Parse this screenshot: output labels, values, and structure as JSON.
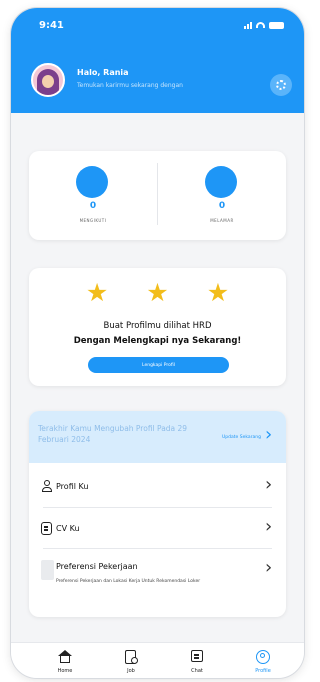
{
  "status_bar": {
    "time": "9:41",
    "icons": [
      "signal-icon",
      "wifi-icon",
      "battery-icon"
    ]
  },
  "header": {
    "greeting": "Halo, Rania",
    "subtitle": "Temukan karirmu sekarang dengan",
    "settings_icon": "gear-icon",
    "color": "#1e96f6"
  },
  "stats": [
    {
      "value": "0",
      "label": "MENGIKUTI"
    },
    {
      "value": "0",
      "label": "MELAMAR"
    }
  ],
  "promo": {
    "star_count": 3,
    "line1": "Buat Profilmu dilihat HRD",
    "line2": "Dengan Melengkapi nya Sekarang!",
    "button": "Lengkapi Profil"
  },
  "notice": {
    "text": "Terakhir Kamu Mengubah Profil Pada 29 Februari 2024",
    "link": "Update Sekarang"
  },
  "menu": [
    {
      "label": "Profil Ku",
      "icon": "person-icon"
    },
    {
      "label": "CV Ku",
      "icon": "document-icon"
    },
    {
      "label": "Preferensi Pekerjaan",
      "subtitle": "Preferensi Pekerjaan dan Lokasi Kerja Untuk Rekomendasi Loker"
    }
  ],
  "nav": [
    {
      "label": "Home",
      "icon": "home-icon"
    },
    {
      "label": "Job",
      "icon": "job-search-icon"
    },
    {
      "label": "Chat",
      "icon": "chat-icon"
    },
    {
      "label": "Profile",
      "icon": "profile-icon",
      "active": true
    }
  ],
  "colors": {
    "primary": "#1e96f6",
    "star": "#f2bd1b",
    "notice_bg": "#d7ecfd"
  }
}
